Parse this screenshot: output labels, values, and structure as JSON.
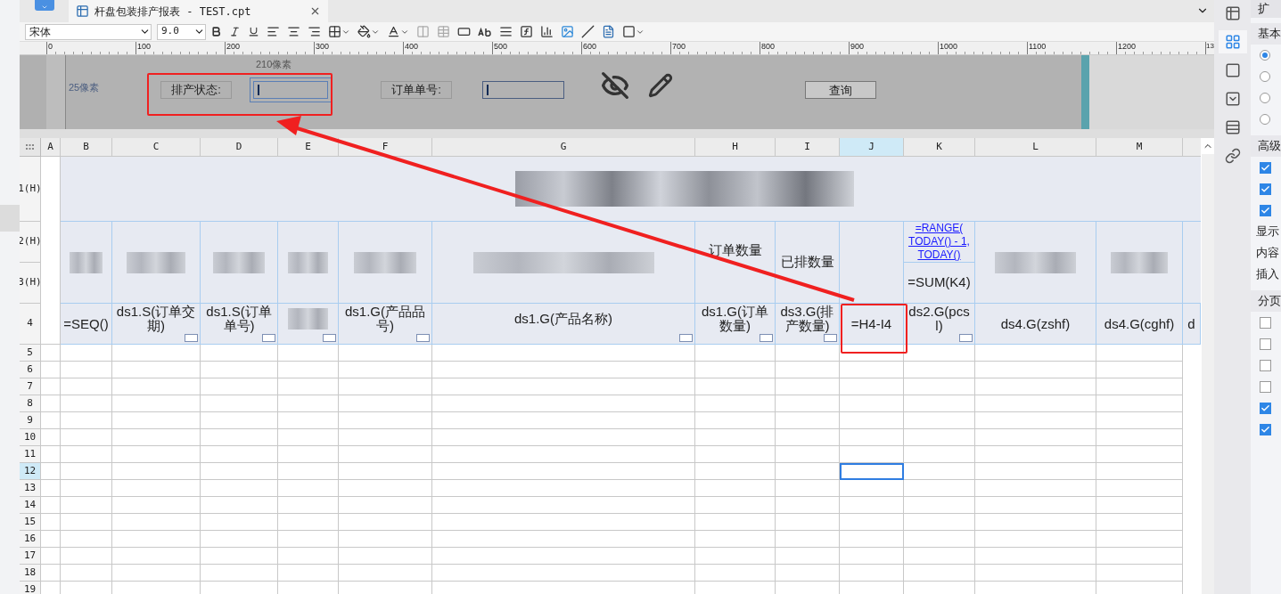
{
  "tabs": [
    {
      "label": "杆盘包装排产报表 - TEST.cpt",
      "selected": true
    }
  ],
  "toolbar": {
    "font": "宋体",
    "font_size": "9.0"
  },
  "ruler": {
    "ticks": [
      "0",
      "100",
      "200",
      "300",
      "400",
      "500",
      "600",
      "700",
      "800",
      "900",
      "1000",
      "1100",
      "1200",
      "13"
    ]
  },
  "form": {
    "width_label": "210像素",
    "height_label": "25像素",
    "widgets": [
      {
        "kind": "label",
        "text": "排产状态:"
      },
      {
        "kind": "input",
        "selected": true
      },
      {
        "kind": "label",
        "text": "订单单号:"
      },
      {
        "kind": "input",
        "selected": false
      },
      {
        "kind": "button",
        "text": "查询"
      }
    ]
  },
  "sheet": {
    "columns": [
      {
        "label": "A",
        "selected": false
      },
      {
        "label": "B",
        "selected": false
      },
      {
        "label": "C",
        "selected": false
      },
      {
        "label": "D",
        "selected": false
      },
      {
        "label": "E",
        "selected": false
      },
      {
        "label": "F",
        "selected": false
      },
      {
        "label": "G",
        "selected": false
      },
      {
        "label": "H",
        "selected": false
      },
      {
        "label": "I",
        "selected": false
      },
      {
        "label": "J",
        "selected": true
      },
      {
        "label": "K",
        "selected": false
      },
      {
        "label": "L",
        "selected": false
      },
      {
        "label": "M",
        "selected": false
      }
    ],
    "rows": [
      {
        "label": "1(H)",
        "selected": false
      },
      {
        "label": "2(H)",
        "selected": false
      },
      {
        "label": "3(H)",
        "selected": false
      },
      {
        "label": "4",
        "selected": false
      },
      {
        "label": "5",
        "selected": false
      },
      {
        "label": "6",
        "selected": false
      },
      {
        "label": "7",
        "selected": false
      },
      {
        "label": "8",
        "selected": false
      },
      {
        "label": "9",
        "selected": false
      },
      {
        "label": "10",
        "selected": false
      },
      {
        "label": "11",
        "selected": false
      },
      {
        "label": "12",
        "selected": true
      },
      {
        "label": "13",
        "selected": false
      },
      {
        "label": "14",
        "selected": false
      },
      {
        "label": "15",
        "selected": false
      },
      {
        "label": "16",
        "selected": false
      },
      {
        "label": "17",
        "selected": false
      },
      {
        "label": "18",
        "selected": false
      },
      {
        "label": "19",
        "selected": false
      }
    ],
    "header_cells": [
      {
        "kind": "blurred"
      },
      {
        "kind": "blurred"
      },
      {
        "kind": "blurred"
      },
      {
        "kind": "blurred"
      },
      {
        "kind": "blurred"
      },
      {
        "kind": "blurred"
      },
      {
        "kind": "text",
        "text": "订单数量"
      },
      {
        "kind": "text",
        "text": "已排数量"
      },
      {
        "kind": "link",
        "text": "=RANGE( TODAY() - 1, TODAY()"
      },
      {
        "kind": "text",
        "text": "=SUM(K4)"
      },
      {
        "kind": "blurred"
      },
      {
        "kind": "blurred"
      }
    ],
    "data_row": [
      {
        "kind": "text",
        "text": "=SEQ()",
        "widget": false
      },
      {
        "kind": "text",
        "text": "ds1.S(订单交期)",
        "widget": true
      },
      {
        "kind": "text",
        "text": "ds1.S(订单单号)",
        "widget": true
      },
      {
        "kind": "blurred",
        "widget": true
      },
      {
        "kind": "text",
        "text": "ds1.G(产品品号)",
        "widget": true
      },
      {
        "kind": "text",
        "text": "ds1.G(产品名称)",
        "widget": true
      },
      {
        "kind": "text",
        "text": "ds1.G(订单数量)",
        "widget": true
      },
      {
        "kind": "text",
        "text": "ds3.G(排产数量)",
        "widget": true
      },
      {
        "kind": "text",
        "text": "=H4-I4",
        "widget": false
      },
      {
        "kind": "text",
        "text": "ds2.G(pcsl)",
        "widget": true
      },
      {
        "kind": "text",
        "text": "ds4.G(zshf)",
        "widget": false
      },
      {
        "kind": "text",
        "text": "ds4.G(cghf)",
        "widget": false
      },
      {
        "kind": "text",
        "text": "d",
        "widget": false
      }
    ]
  },
  "side_tabs": [
    {
      "selected": false
    },
    {
      "selected": true
    },
    {
      "selected": false
    },
    {
      "selected": false
    },
    {
      "selected": false
    },
    {
      "selected": false
    }
  ],
  "panel": {
    "title": "扩",
    "sections": [
      {
        "title": "基本",
        "items": [
          {
            "kind": "radio",
            "checked": true
          },
          {
            "kind": "radio",
            "checked": false
          },
          {
            "kind": "radio",
            "checked": false
          },
          {
            "kind": "radio",
            "checked": false
          }
        ]
      },
      {
        "title": "高级",
        "items": [
          {
            "kind": "checkbox",
            "checked": true
          },
          {
            "kind": "checkbox",
            "checked": true
          },
          {
            "kind": "checkbox",
            "checked": true
          },
          {
            "kind": "text",
            "label": "显示"
          },
          {
            "kind": "text",
            "label": "内容"
          },
          {
            "kind": "text",
            "label": "插入"
          }
        ]
      },
      {
        "title": "分页",
        "items": [
          {
            "kind": "checkbox",
            "checked": false
          },
          {
            "kind": "checkbox",
            "checked": false
          },
          {
            "kind": "checkbox",
            "checked": false
          },
          {
            "kind": "checkbox",
            "checked": false
          },
          {
            "kind": "checkbox",
            "checked": true
          },
          {
            "kind": "checkbox",
            "checked": true
          }
        ]
      }
    ]
  }
}
